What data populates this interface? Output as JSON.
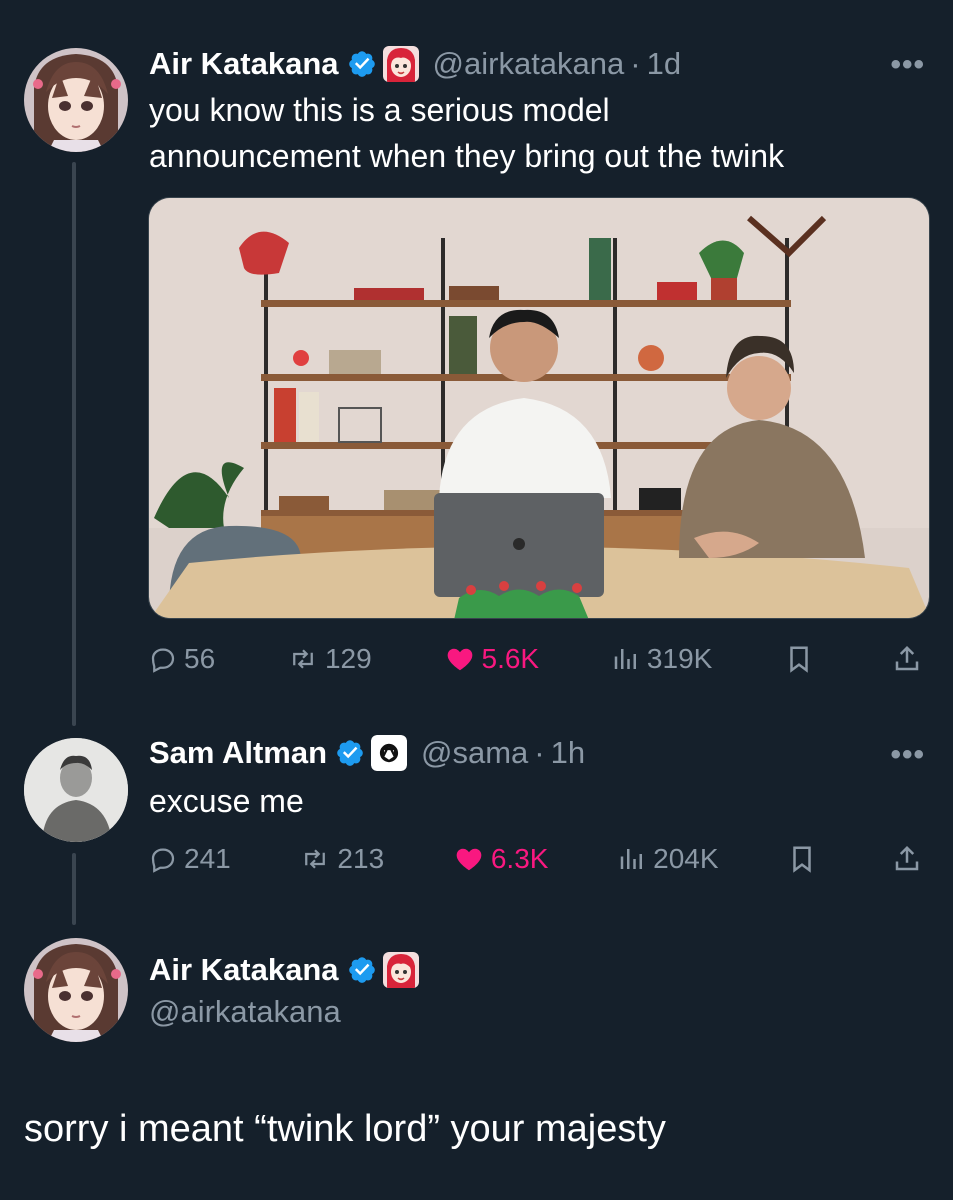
{
  "colors": {
    "background": "#15202b",
    "muted": "#8b98a5",
    "verified_blue": "#1d9bf0",
    "like_pink": "#f91880",
    "thread_line": "#3a4550"
  },
  "tweet1": {
    "avatar_icon": "anime-girl-avatar-icon",
    "name": "Air Katakana",
    "handle": "@airkatakana",
    "dot": "·",
    "time": "1d",
    "more": "•••",
    "text_line1": "you know this is a serious model",
    "text_line2": "announcement when they bring out the twink",
    "media_icon": "video-thumbnail-two-men-at-table",
    "stats": {
      "replies": "56",
      "reposts": "129",
      "likes": "5.6K",
      "views": "319K"
    }
  },
  "tweet2": {
    "avatar_icon": "photo-avatar-icon",
    "name": "Sam Altman",
    "handle": "@sama",
    "dot": "·",
    "time": "1h",
    "more": "•••",
    "text": "excuse me",
    "stats": {
      "replies": "241",
      "reposts": "213",
      "likes": "6.3K",
      "views": "204K"
    }
  },
  "tweet3": {
    "avatar_icon": "anime-girl-avatar-icon",
    "name": "Air Katakana",
    "handle": "@airkatakana",
    "text": "sorry i meant “twink lord” your majesty"
  }
}
